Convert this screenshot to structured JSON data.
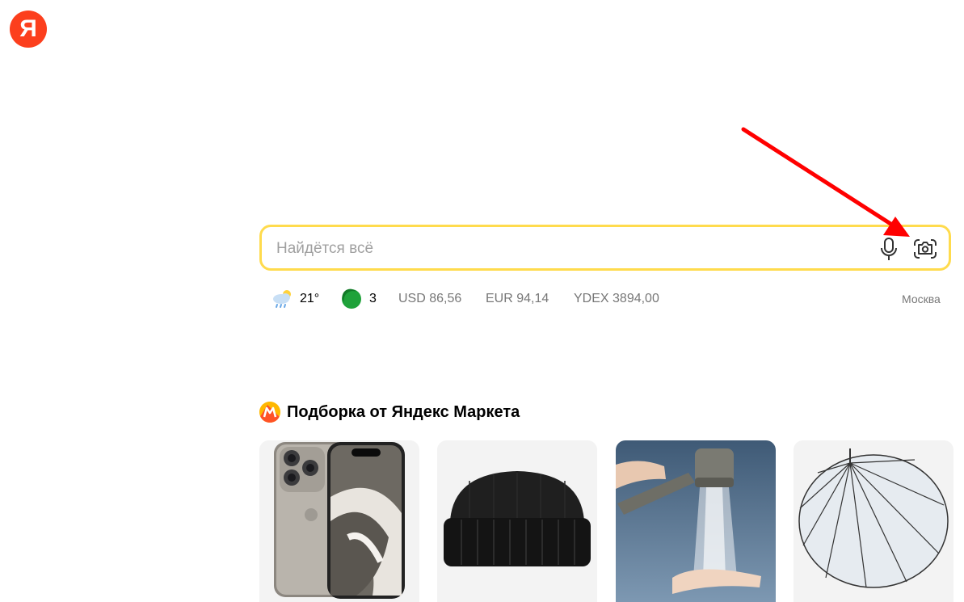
{
  "logo": {
    "text": "Я"
  },
  "search": {
    "placeholder": "Найдётся всё",
    "value": ""
  },
  "informers": {
    "weather": {
      "temp": "21°",
      "icon": "rain-cloud-sun-icon"
    },
    "traffic": {
      "score": "3",
      "icon": "traffic-circle-icon",
      "color": "#1fa23a"
    },
    "usd": "USD 86,56",
    "eur": "EUR 94,14",
    "ydex": "YDEX 3894,00",
    "city": "Москва"
  },
  "market": {
    "title": "Подборка от Яндекс Маркета",
    "icon": "yandex-market-icon",
    "products": [
      {
        "name": "iphone",
        "icon": "smartphone-image"
      },
      {
        "name": "beanie",
        "icon": "knit-hat-image"
      },
      {
        "name": "shower-head",
        "icon": "shower-head-image"
      },
      {
        "name": "umbrella",
        "icon": "umbrella-image"
      }
    ]
  },
  "colors": {
    "brand_red": "#fc3f1d",
    "search_border": "#ffdb4d",
    "annotation_arrow": "#ff0000"
  }
}
